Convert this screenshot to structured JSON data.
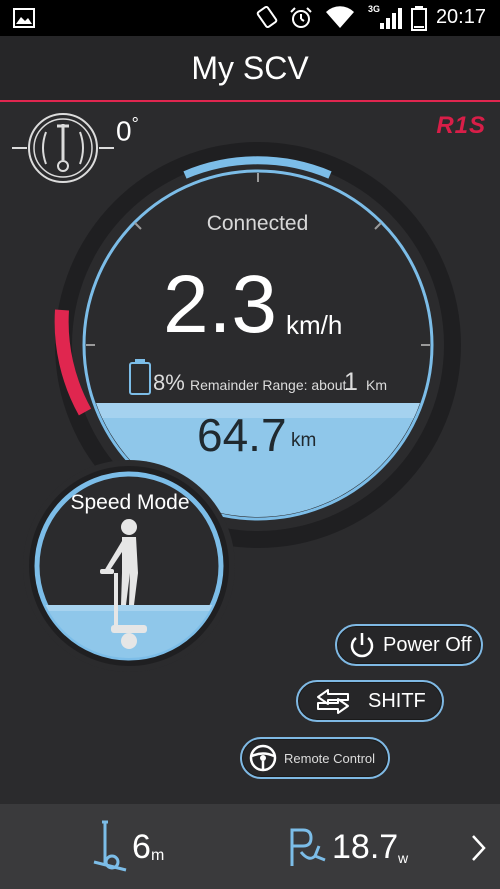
{
  "status_bar": {
    "time": "20:17",
    "network_label": "3G",
    "icons": [
      "image-icon",
      "rotation-icon",
      "alarm-icon",
      "wifi-icon",
      "signal-icon",
      "battery-icon"
    ]
  },
  "header": {
    "title": "My SCV",
    "accent_color": "#e0264f"
  },
  "brand": {
    "logo_text": "R1S",
    "color": "#d81e48"
  },
  "tilt": {
    "value": "0",
    "unit": "°"
  },
  "gauge": {
    "status": "Connected",
    "speed_value": "2.3",
    "speed_unit": "km/h",
    "battery_percent": "8%",
    "range_label": "Remainder Range: about",
    "range_value": "1",
    "range_unit": "Km",
    "odometer_value": "64.7",
    "odometer_unit": "km",
    "ring_color": "#7cbde8",
    "warning_color": "#e0264f"
  },
  "mode": {
    "title": "Speed Mode"
  },
  "buttons": {
    "power_off": "Power Off",
    "shift": "SHITF",
    "remote_control": "Remote Control"
  },
  "bottom_bar": {
    "distance_value": "6",
    "distance_unit": "m",
    "power_value": "18.7",
    "power_unit": "w"
  }
}
